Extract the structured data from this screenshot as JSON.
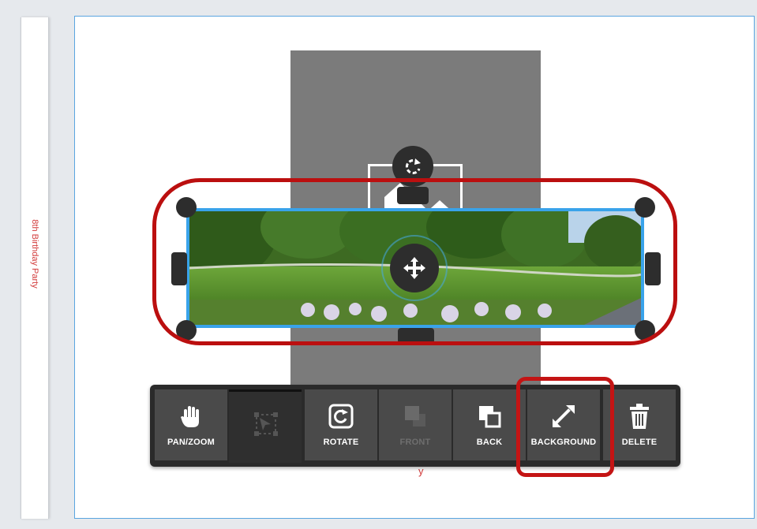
{
  "spine": {
    "title": "8th Birthday Party"
  },
  "colors": {
    "accent": "#39a3ea",
    "highlight": "#bb0f0f",
    "toolbar": "#2a2a2a"
  },
  "canvas": {
    "rotate_icon": "rotate-arrow-icon",
    "move_icon": "move-arrows-icon",
    "image_icon": "image-placeholder-icon"
  },
  "toolbar": {
    "items": [
      {
        "label": "PAN/ZOOM",
        "icon": "hand-icon",
        "state": "normal"
      },
      {
        "label": "",
        "icon": "crop-select-icon",
        "state": "selected"
      },
      {
        "label": "ROTATE",
        "icon": "rotate-icon",
        "state": "normal"
      },
      {
        "label": "FRONT",
        "icon": "bring-front-icon",
        "state": "disabled"
      },
      {
        "label": "BACK",
        "icon": "send-back-icon",
        "state": "normal"
      },
      {
        "label": "BACKGROUND",
        "icon": "expand-icon",
        "state": "normal"
      },
      {
        "label": "DELETE",
        "icon": "trash-icon",
        "state": "normal"
      }
    ]
  }
}
